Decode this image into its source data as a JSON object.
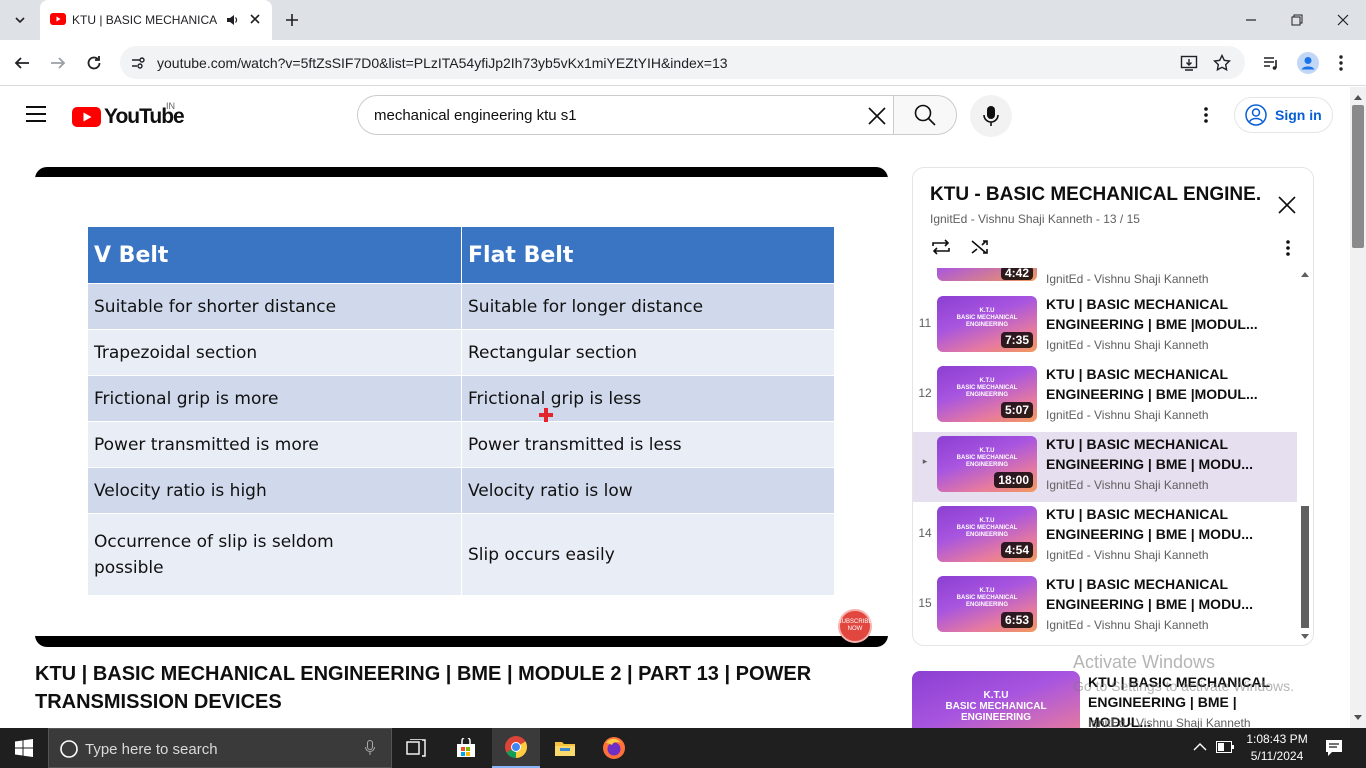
{
  "browser": {
    "tab_title": "KTU | BASIC MECHANICAL ENGINEERING",
    "url": "youtube.com/watch?v=5ftZsSIF7D0&list=PLzITA54yfiJp2Ih73yb5vKx1miYEZtYIH&index=13"
  },
  "youtube": {
    "logo": "YouTube",
    "region": "IN",
    "search_value": "mechanical engineering ktu s1",
    "sign_in": "Sign in"
  },
  "slide": {
    "headers": [
      "V Belt",
      "Flat Belt"
    ],
    "rows": [
      [
        "Suitable for shorter distance",
        "Suitable for longer distance"
      ],
      [
        "Trapezoidal section",
        "Rectangular section"
      ],
      [
        "Frictional grip is more",
        "Frictional grip is less"
      ],
      [
        "Power transmitted is more",
        "Power transmitted is less"
      ],
      [
        "Velocity ratio is high",
        "Velocity ratio is low"
      ],
      [
        "Occurrence of slip is seldom possible",
        "Slip occurs easily"
      ]
    ],
    "subscribe_line1": "SUBSCRIBE",
    "subscribe_line2": "NOW"
  },
  "video_title": "KTU | BASIC MECHANICAL ENGINEERING | BME | MODULE 2 | PART 13 | POWER TRANSMISSION DEVICES",
  "playlist": {
    "title": "KTU - BASIC MECHANICAL ENGINE...",
    "subtitle": "IgnitEd - Vishnu Shaji Kanneth - 13 / 15",
    "partial_channel": "IgnitEd - Vishnu Shaji Kanneth",
    "partial_duration": "4:42",
    "items": [
      {
        "num": "11",
        "title": "KTU | BASIC MECHANICAL ENGINEERING | BME |MODUL...",
        "channel": "IgnitEd - Vishnu Shaji Kanneth",
        "duration": "7:35",
        "thumb_line1": "K.T.U",
        "thumb_line2": "BASIC MECHANICAL ENGINEERING"
      },
      {
        "num": "12",
        "title": "KTU | BASIC MECHANICAL ENGINEERING | BME |MODUL...",
        "channel": "IgnitEd - Vishnu Shaji Kanneth",
        "duration": "5:07",
        "thumb_line1": "K.T.U",
        "thumb_line2": "BASIC MECHANICAL ENGINEERING"
      },
      {
        "num": "▸",
        "title": "KTU | BASIC MECHANICAL ENGINEERING | BME | MODU...",
        "channel": "IgnitEd - Vishnu Shaji Kanneth",
        "duration": "18:00",
        "thumb_line1": "K.T.U",
        "thumb_line2": "BASIC MECHANICAL ENGINEERING"
      },
      {
        "num": "14",
        "title": "KTU | BASIC MECHANICAL ENGINEERING | BME | MODU...",
        "channel": "IgnitEd - Vishnu Shaji Kanneth",
        "duration": "4:54",
        "thumb_line1": "K.T.U",
        "thumb_line2": "BASIC MECHANICAL ENGINEERING"
      },
      {
        "num": "15",
        "title": "KTU | BASIC MECHANICAL ENGINEERING | BME | MODU...",
        "channel": "IgnitEd - Vishnu Shaji Kanneth",
        "duration": "6:53",
        "thumb_line1": "K.T.U",
        "thumb_line2": "BASIC MECHANICAL ENGINEERING"
      }
    ]
  },
  "recommended": {
    "thumb_line1": "K.T.U",
    "thumb_line2": "BASIC MECHANICAL ENGINEERING",
    "title": "KTU | BASIC MECHANICAL ENGINEERING | BME | MODUL...",
    "channel": "IgnitEd - Vishnu Shaji Kanneth"
  },
  "watermark": {
    "line1": "Activate Windows",
    "line2": "Go to Settings to activate Windows."
  },
  "taskbar": {
    "search_placeholder": "Type here to search",
    "time": "1:08:43 PM",
    "date": "5/11/2024"
  },
  "colors": {
    "accent": "#3a75c4",
    "youtube_red": "#ff0000",
    "link_blue": "#065fd4"
  }
}
